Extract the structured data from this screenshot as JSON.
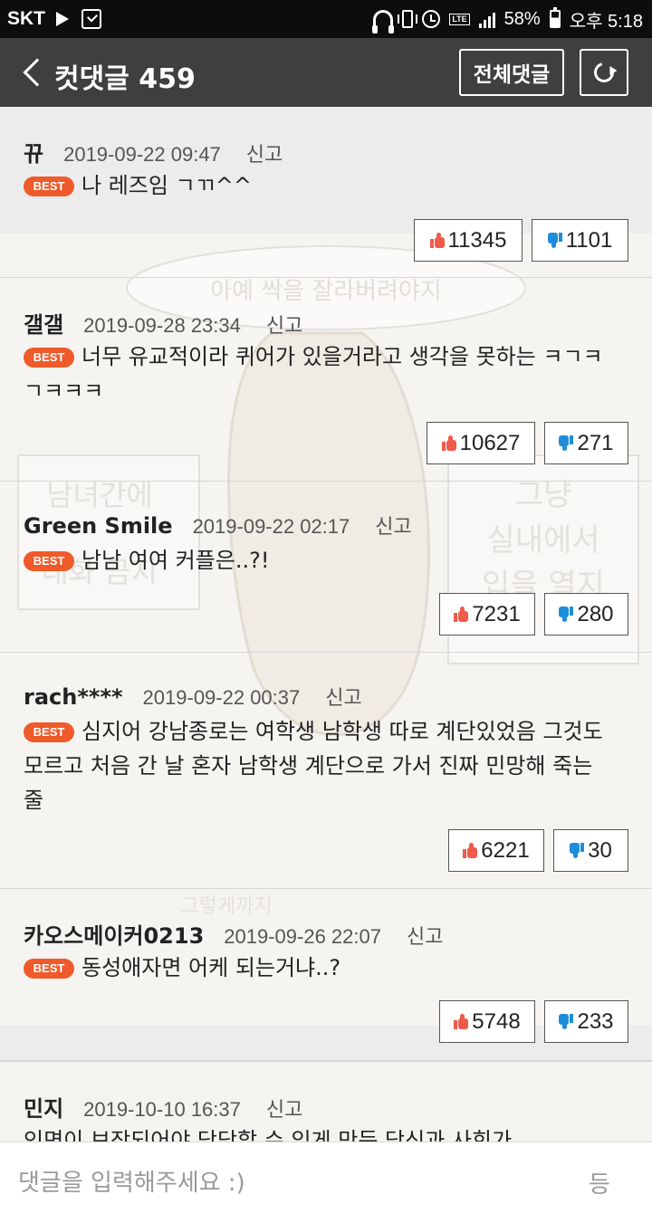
{
  "status_bar": {
    "carrier": "SKT",
    "battery": "58%",
    "time": "오후 5:18",
    "icons": [
      "play-icon",
      "check-box-icon",
      "headset-icon",
      "vibrate-icon",
      "alarm-icon",
      "lte-icon",
      "signal-icon",
      "battery-icon"
    ]
  },
  "header": {
    "title": "컷댓글 459",
    "all_comments_label": "전체댓글",
    "icons": [
      "back-icon",
      "refresh-icon"
    ]
  },
  "best_badge": "BEST",
  "comments": [
    {
      "user": "뀨",
      "date": "2019-09-22 09:47",
      "report": "신고",
      "best": true,
      "text": "나 레즈임 ㄱㄲ^^",
      "likes": "11345",
      "dislikes": "1101"
    },
    {
      "user": "갤갤",
      "date": "2019-09-28 23:34",
      "report": "신고",
      "best": true,
      "text": "너무 유교적이라 퀴어가 있을거라고 생각을 못하는 ㅋㄱㅋㄱㅋㅋㅋ",
      "likes": "10627",
      "dislikes": "271"
    },
    {
      "user": "Green Smile",
      "date": "2019-09-22 02:17",
      "report": "신고",
      "best": true,
      "text": "남남 여여 커플은..?!",
      "likes": "7231",
      "dislikes": "280"
    },
    {
      "user": "rach****",
      "date": "2019-09-22 00:37",
      "report": "신고",
      "best": true,
      "text": "심지어 강남종로는 여학생 남학생 따로 계단있었음 그것도 모르고 처음 간 날 혼자 남학생 계단으로 가서 진짜 민망해 죽는줄",
      "likes": "6221",
      "dislikes": "30"
    },
    {
      "user": "카오스메이커0213",
      "date": "2019-09-26 22:07",
      "report": "신고",
      "best": true,
      "text": "동성애자면 어케 되는거냐..?",
      "likes": "5748",
      "dislikes": "233"
    },
    {
      "user": "민지",
      "date": "2019-10-10 16:37",
      "report": "신고",
      "best": false,
      "text": "인면이 보장되어야 당당할 수 있게 만든 당신과 사회가",
      "likes": "",
      "dislikes": ""
    }
  ],
  "background_art": {
    "speech_bubble": "아예 싹을 잘라버려야지",
    "left_sign": [
      "남녀간에",
      "대화 금지"
    ],
    "right_sign": [
      "그냥",
      "실내에서",
      "입을 열지"
    ],
    "bottom_text": "그렇게까지"
  },
  "input_bar": {
    "placeholder": "댓글을 입력해주세요 :)",
    "submit_label": "등"
  }
}
